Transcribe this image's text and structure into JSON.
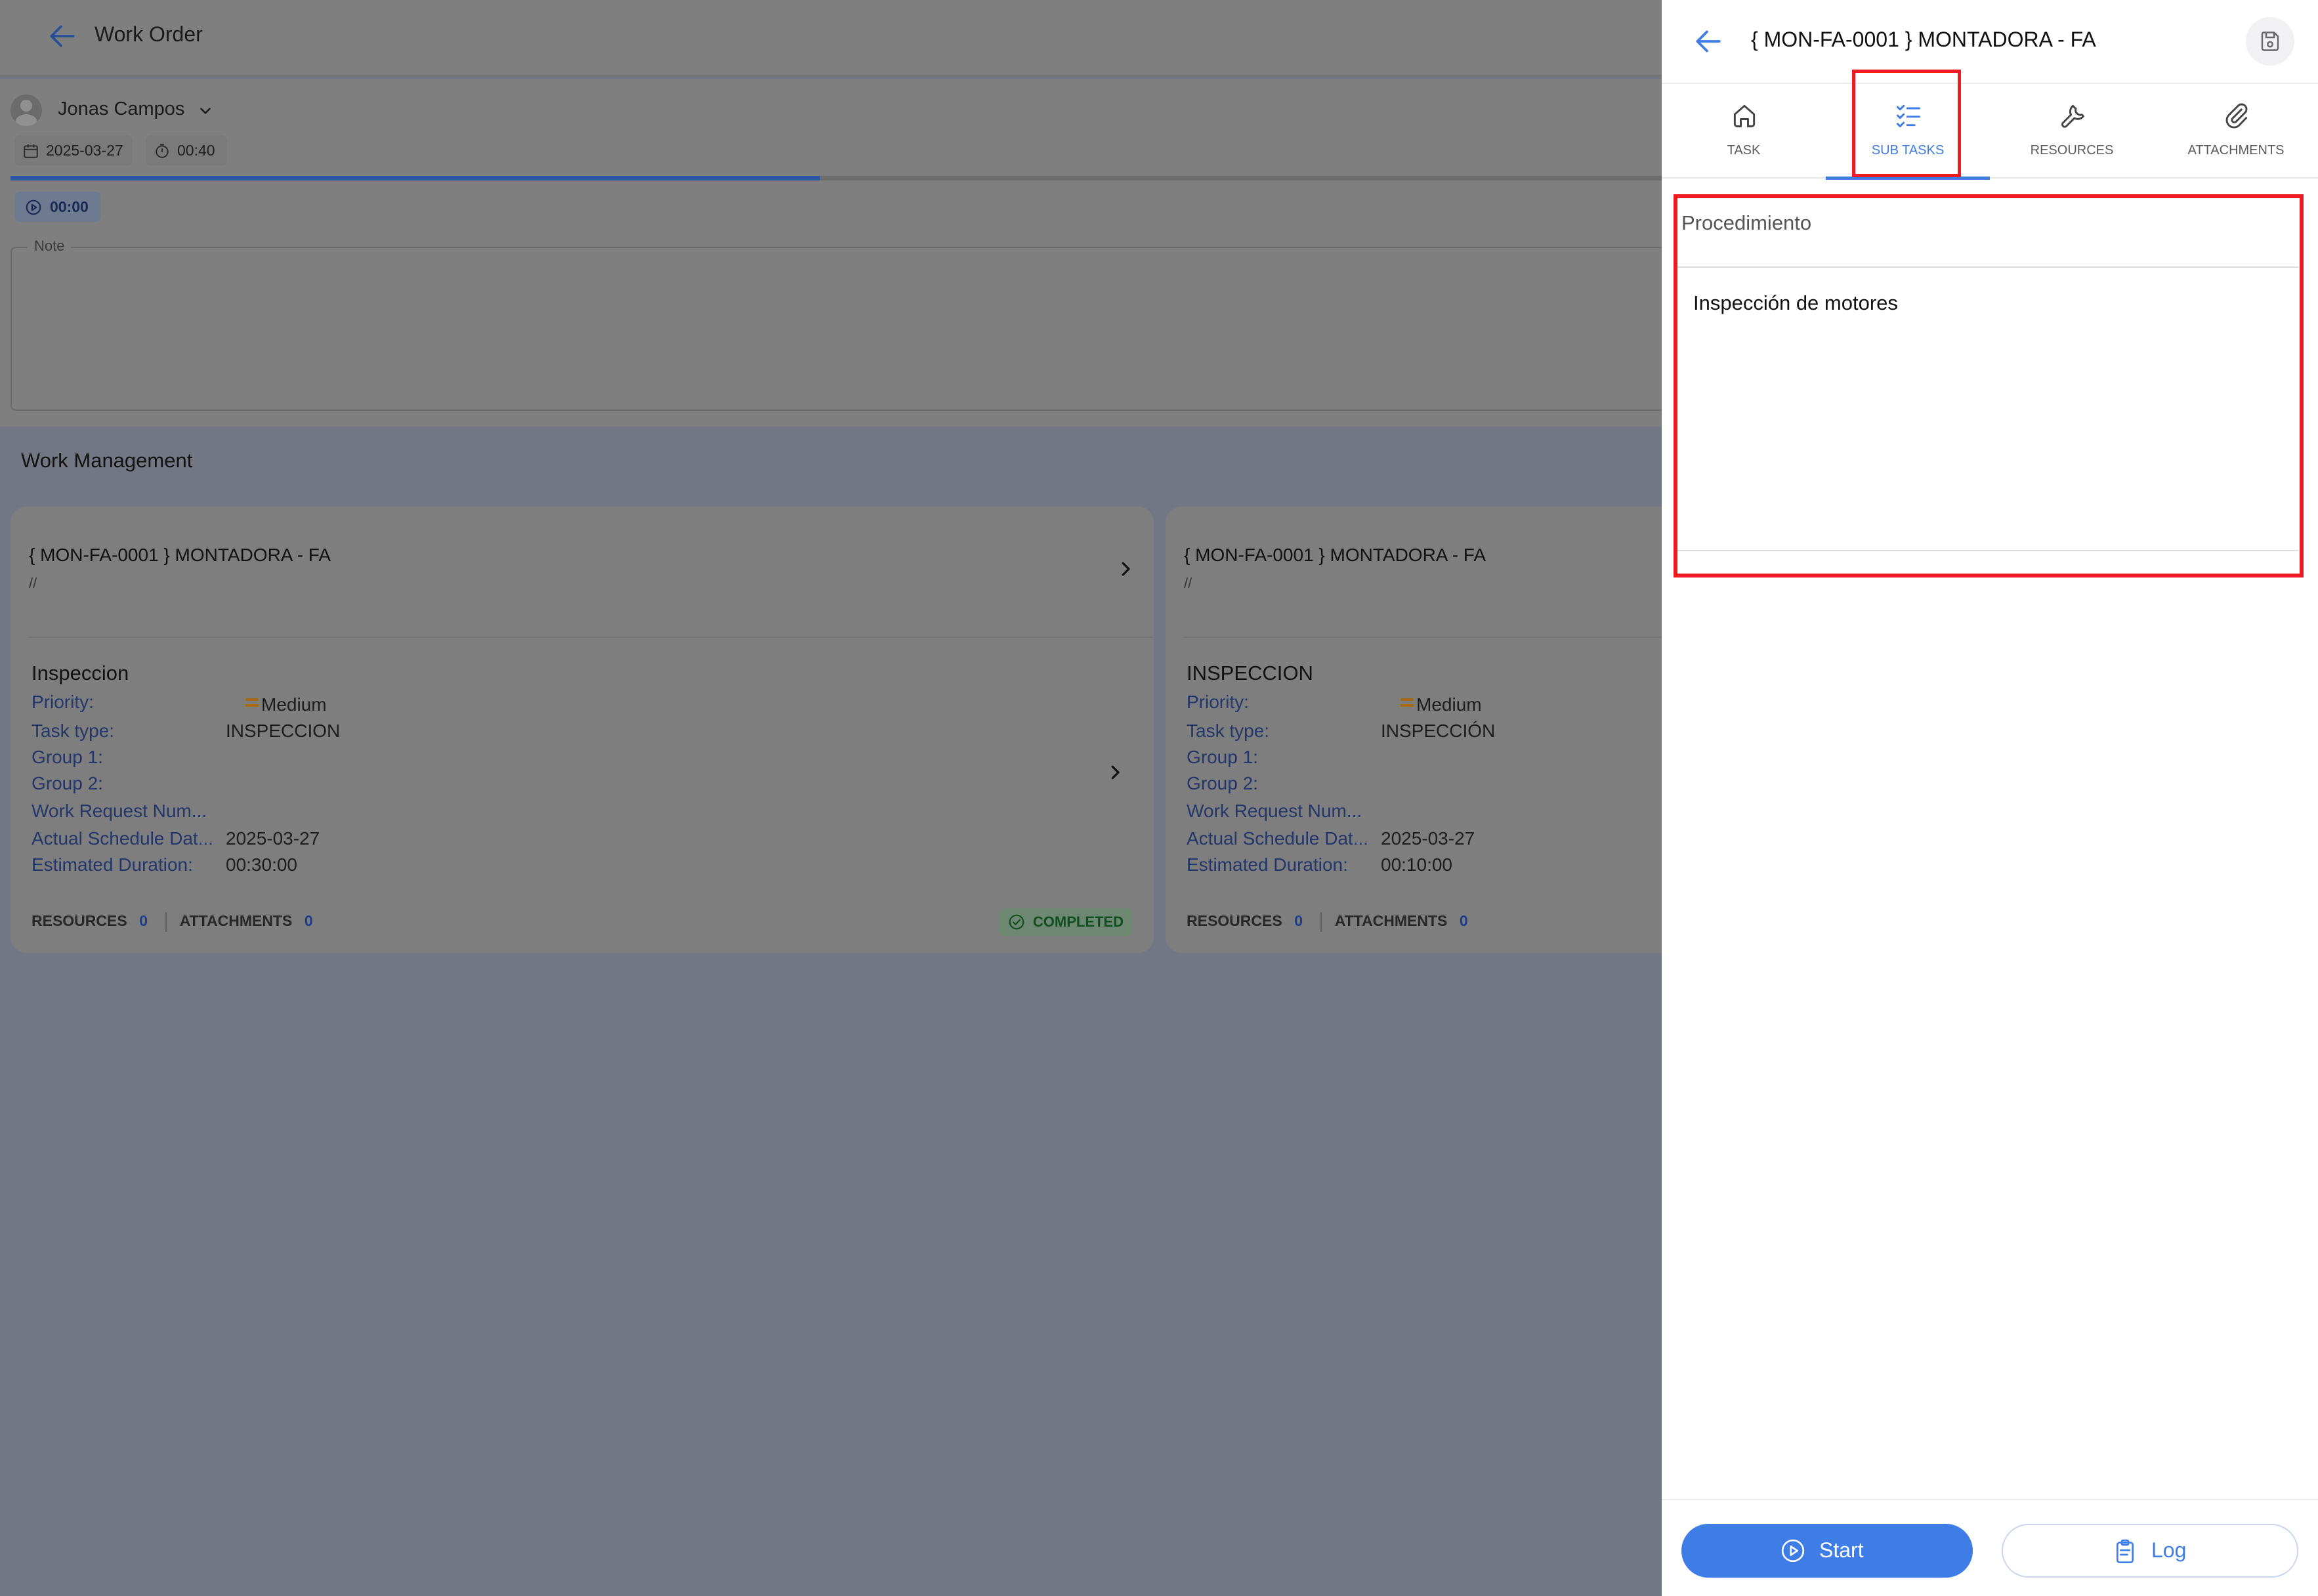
{
  "background": {
    "header": {
      "title": "Work Order"
    },
    "user": {
      "name": "Jonas Campos"
    },
    "chips": {
      "date": "2025-03-27",
      "duration": "00:40",
      "timer": "00:00"
    },
    "progress": 0.49,
    "note": {
      "label": "Note",
      "value": ""
    },
    "section_title": "Work Management",
    "cards": [
      {
        "header": "{ MON-FA-0001 } MONTADORA - FA",
        "subheader": "//",
        "task_title": "Inspeccion",
        "fields": {
          "priority_label": "Priority:",
          "priority": "Medium",
          "task_type_label": "Task type:",
          "task_type": "INSPECCION",
          "group1_label": "Group 1:",
          "group1": "",
          "group2_label": "Group 2:",
          "group2": "",
          "work_request_label": "Work Request Num...",
          "work_request": "",
          "schedule_label": "Actual Schedule Dat...",
          "schedule": "2025-03-27",
          "duration_label": "Estimated Duration:",
          "duration": "00:30:00"
        },
        "footer": {
          "resources_label": "RESOURCES",
          "resources": "0",
          "attachments_label": "ATTACHMENTS",
          "attachments": "0",
          "status": "COMPLETED"
        }
      },
      {
        "header": "{ MON-FA-0001 } MONTADORA - FA",
        "subheader": "//",
        "task_title": "INSPECCION",
        "fields": {
          "priority_label": "Priority:",
          "priority": "Medium",
          "task_type_label": "Task type:",
          "task_type": "INSPECCIÓN",
          "group1_label": "Group 1:",
          "group1": "",
          "group2_label": "Group 2:",
          "group2": "",
          "work_request_label": "Work Request Num...",
          "work_request": "",
          "schedule_label": "Actual Schedule Dat...",
          "schedule": "2025-03-27",
          "duration_label": "Estimated Duration:",
          "duration": "00:10:00"
        },
        "footer": {
          "resources_label": "RESOURCES",
          "resources": "0",
          "attachments_label": "ATTACHMENTS",
          "attachments": "0"
        }
      }
    ]
  },
  "drawer": {
    "title": "{ MON-FA-0001 } MONTADORA - FA",
    "tabs": [
      {
        "label": "TASK",
        "icon": "home-icon"
      },
      {
        "label": "SUB TASKS",
        "icon": "checklist-icon",
        "active": true
      },
      {
        "label": "RESOURCES",
        "icon": "wrench-icon"
      },
      {
        "label": "ATTACHMENTS",
        "icon": "paperclip-icon"
      }
    ],
    "procedure": {
      "label": "Procedimiento",
      "text": "Inspección de motores"
    },
    "actions": {
      "start": "Start",
      "log": "Log"
    }
  },
  "colors": {
    "accent": "#3e7ce6",
    "highlight": "#ee1b22",
    "overlay": "#737784"
  }
}
